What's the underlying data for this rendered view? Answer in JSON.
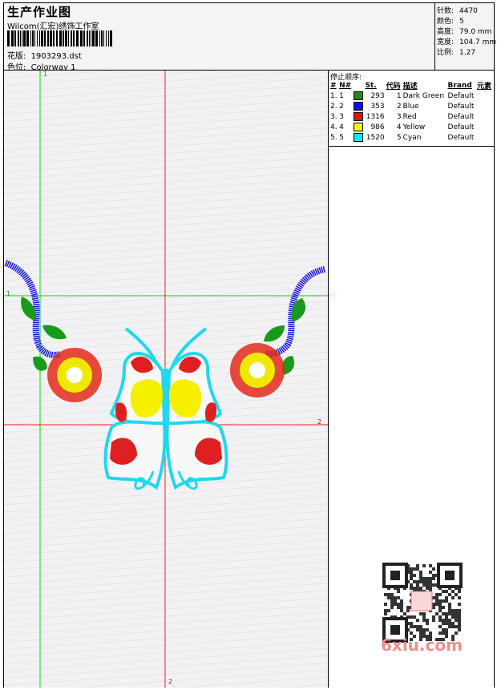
{
  "header": {
    "title": "生产作业图",
    "company": "Wilcom(汇宏)绣饰工作室",
    "design_label": "花版:",
    "design_value": "1903293.dst",
    "colorway_label": "色位:",
    "colorway_value": "Colorway 1"
  },
  "stats": [
    {
      "label": "针数:",
      "value": "4470"
    },
    {
      "label": "颜色:",
      "value": "5"
    },
    {
      "label": "高度:",
      "value": "79.0 mm"
    },
    {
      "label": "宽度:",
      "value": "104.7 mm"
    },
    {
      "label": "比例:",
      "value": "1.27"
    }
  ],
  "stop_sequence": {
    "title": "停止顺序:",
    "headers": [
      "#",
      "N#",
      "St.",
      "代码",
      "描述",
      "Brand",
      "元素"
    ],
    "rows": [
      {
        "n": "1.",
        "nn": "1",
        "color": "#1a8a1a",
        "st": "293",
        "code": "1",
        "desc": "Dark Green",
        "brand": "Default"
      },
      {
        "n": "2.",
        "nn": "2",
        "color": "#1010e0",
        "st": "353",
        "code": "2",
        "desc": "Blue",
        "brand": "Default"
      },
      {
        "n": "3.",
        "nn": "3",
        "color": "#e01010",
        "st": "1316",
        "code": "3",
        "desc": "Red",
        "brand": "Default"
      },
      {
        "n": "4.",
        "nn": "4",
        "color": "#f5f500",
        "st": "986",
        "code": "4",
        "desc": "Yellow",
        "brand": "Default"
      },
      {
        "n": "5.",
        "nn": "5",
        "color": "#20e0f0",
        "st": "1520",
        "code": "5",
        "desc": "Cyan",
        "brand": "Default"
      }
    ]
  },
  "guides": {
    "v1": "1",
    "h1": "1",
    "v2": "2",
    "h2": "2"
  },
  "watermark": {
    "text": "6xiu.com"
  },
  "colors": {
    "guide_green": "#00dd00",
    "guide_red": "#ee2222"
  }
}
